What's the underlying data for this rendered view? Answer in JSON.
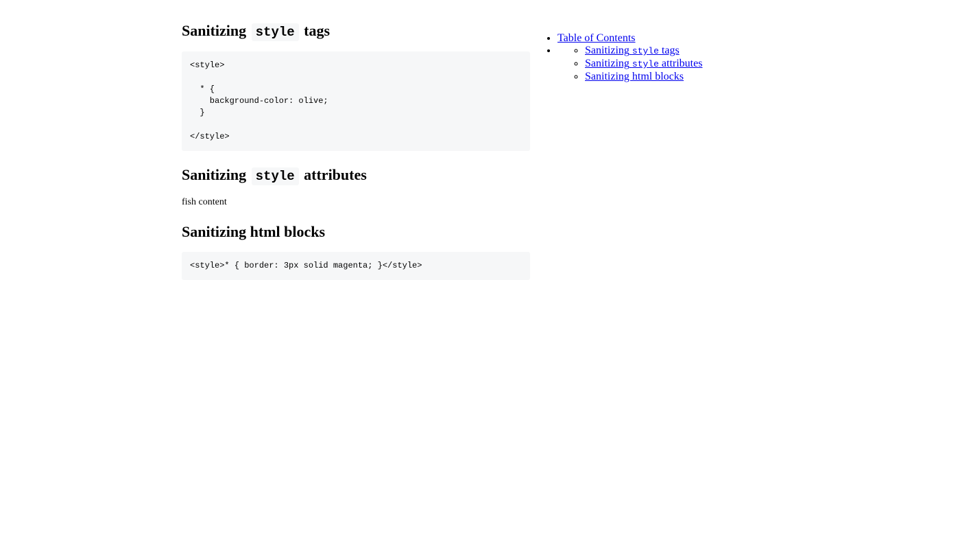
{
  "sections": [
    {
      "title_pre": "Sanitizing",
      "title_code": "style",
      "title_post": "tags",
      "code": "<style>\n\n  * {\n    background-color: olive;\n  }\n\n</style>"
    },
    {
      "title_pre": "Sanitizing",
      "title_code": "style",
      "title_post": "attributes",
      "text": "fish content"
    },
    {
      "title": "Sanitizing html blocks",
      "code": "<style>* { border: 3px solid magenta; }</style>"
    }
  ],
  "toc": {
    "title": "Table of Contents",
    "items": [
      {
        "pre": "Sanitizing",
        "code": "style",
        "post": "tags"
      },
      {
        "pre": "Sanitizing",
        "code": "style",
        "post": "attributes"
      },
      {
        "label": "Sanitizing html blocks"
      }
    ]
  }
}
